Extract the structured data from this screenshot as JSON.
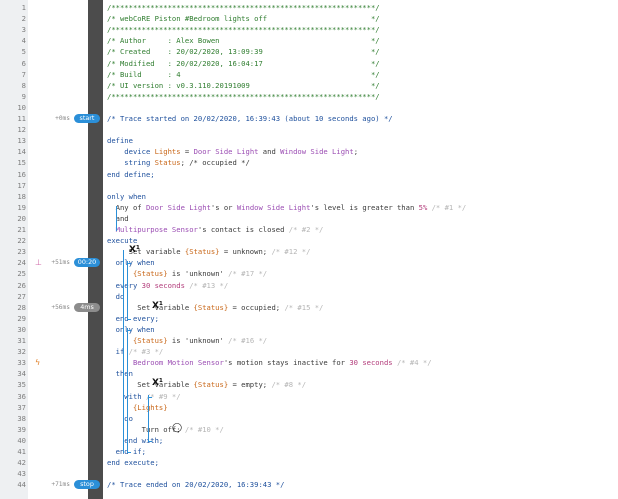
{
  "lines": [
    {
      "n": "1",
      "t": [
        [
          "/*************************************************************/",
          "c"
        ]
      ]
    },
    {
      "n": "2",
      "t": [
        [
          "/* webCoRE Piston #Bedroom lights off                        */",
          "c"
        ]
      ]
    },
    {
      "n": "3",
      "t": [
        [
          "/*************************************************************/",
          "c"
        ]
      ]
    },
    {
      "n": "4",
      "t": [
        [
          "/* Author     : Alex Bowen                                   */",
          "c"
        ]
      ]
    },
    {
      "n": "5",
      "t": [
        [
          "/* Created    : 20/02/2020, 13:09:39                         */",
          "c"
        ]
      ]
    },
    {
      "n": "6",
      "t": [
        [
          "/* Modified   : 20/02/2020, 16:04:17                         */",
          "c"
        ]
      ]
    },
    {
      "n": "7",
      "t": [
        [
          "/* Build      : 4                                            */",
          "c"
        ]
      ]
    },
    {
      "n": "8",
      "t": [
        [
          "/* UI version : v0.3.110.20191009                            */",
          "c"
        ]
      ]
    },
    {
      "n": "9",
      "t": [
        [
          "/*************************************************************/",
          "c"
        ]
      ]
    },
    {
      "n": "10",
      "t": []
    },
    {
      "n": "11",
      "t": [
        [
          "/* Trace started on 20/02/2020, 16:39:43 (about 10 seconds ago) */",
          "k"
        ]
      ]
    },
    {
      "n": "12",
      "t": []
    },
    {
      "n": "13",
      "t": [
        [
          "define",
          "k"
        ]
      ]
    },
    {
      "n": "14",
      "t": [
        [
          "    device ",
          "k"
        ],
        [
          "Lights",
          "v"
        ],
        [
          " = ",
          "s"
        ],
        [
          "Door Side Light",
          "d"
        ],
        [
          " and ",
          "s"
        ],
        [
          "Window Side Light",
          "d"
        ],
        [
          ";",
          "s"
        ]
      ]
    },
    {
      "n": "15",
      "t": [
        [
          "    string ",
          "k"
        ],
        [
          "Status",
          "v"
        ],
        [
          "; /* occupied */",
          "s"
        ]
      ]
    },
    {
      "n": "16",
      "t": [
        [
          "end define;",
          "k"
        ]
      ]
    },
    {
      "n": "17",
      "t": []
    },
    {
      "n": "18",
      "t": [
        [
          "only when",
          "k"
        ]
      ]
    },
    {
      "n": "19",
      "t": [
        [
          "  Any of ",
          "s"
        ],
        [
          "Door Side Light",
          "d"
        ],
        [
          "'s or ",
          "s"
        ],
        [
          "Window Side Light",
          "d"
        ],
        [
          "'s ",
          "s"
        ],
        [
          "level",
          "s"
        ],
        [
          " is greater than ",
          "s"
        ],
        [
          "5%",
          "n"
        ],
        [
          " /* #1 */",
          "g"
        ]
      ]
    },
    {
      "n": "20",
      "t": [
        [
          "  and",
          "s"
        ]
      ]
    },
    {
      "n": "21",
      "t": [
        [
          "  Multipurpose Sensor",
          "d"
        ],
        [
          "'s ",
          "s"
        ],
        [
          "contact",
          "s"
        ],
        [
          " is closed ",
          "s"
        ],
        [
          "/* #2 */",
          "g"
        ]
      ]
    },
    {
      "n": "22",
      "t": [
        [
          "execute",
          "k"
        ]
      ]
    },
    {
      "n": "23",
      "t": [
        [
          "     Set variable ",
          "s"
        ],
        [
          "{Status}",
          "v"
        ],
        [
          " = unknown; ",
          "s"
        ],
        [
          "/* #12 */",
          "g"
        ]
      ]
    },
    {
      "n": "24",
      "t": [
        [
          "  only when",
          "k"
        ]
      ]
    },
    {
      "n": "25",
      "t": [
        [
          "      ",
          "s"
        ],
        [
          "{Status}",
          "v"
        ],
        [
          " is ",
          "s"
        ],
        [
          "'unknown'",
          "s"
        ],
        [
          " /* #17 */",
          "g"
        ]
      ]
    },
    {
      "n": "26",
      "t": [
        [
          "  every ",
          "k"
        ],
        [
          "30 seconds",
          "n"
        ],
        [
          " /* #13 */",
          "g"
        ]
      ]
    },
    {
      "n": "27",
      "t": [
        [
          "  do",
          "k"
        ]
      ]
    },
    {
      "n": "28",
      "t": [
        [
          "       Set variable ",
          "s"
        ],
        [
          "{Status}",
          "v"
        ],
        [
          " = occupied; ",
          "s"
        ],
        [
          "/* #15 */",
          "g"
        ]
      ]
    },
    {
      "n": "29",
      "t": [
        [
          "  end every;",
          "k"
        ]
      ]
    },
    {
      "n": "30",
      "t": [
        [
          "  only when",
          "k"
        ]
      ]
    },
    {
      "n": "31",
      "t": [
        [
          "      ",
          "s"
        ],
        [
          "{Status}",
          "v"
        ],
        [
          " is ",
          "s"
        ],
        [
          "'unknown'",
          "s"
        ],
        [
          " /* #16 */",
          "g"
        ]
      ]
    },
    {
      "n": "32",
      "t": [
        [
          "  if ",
          "k"
        ],
        [
          "/* #3 */",
          "g"
        ]
      ]
    },
    {
      "n": "33",
      "t": [
        [
          "      Bedroom Motion Sensor",
          "d"
        ],
        [
          "'s ",
          "s"
        ],
        [
          "motion",
          "s"
        ],
        [
          " stays inactive for ",
          "s"
        ],
        [
          "30 seconds",
          "n"
        ],
        [
          " /* #4 */",
          "g"
        ]
      ]
    },
    {
      "n": "34",
      "t": [
        [
          "  then",
          "k"
        ]
      ]
    },
    {
      "n": "35",
      "t": [
        [
          "       Set variable ",
          "s"
        ],
        [
          "{Status}",
          "v"
        ],
        [
          " = empty; ",
          "s"
        ],
        [
          "/* #8 */",
          "g"
        ]
      ]
    },
    {
      "n": "36",
      "t": [
        [
          "    with ",
          "k"
        ],
        [
          "/* #9 */",
          "g"
        ]
      ]
    },
    {
      "n": "37",
      "t": [
        [
          "      ",
          "s"
        ],
        [
          "{Lights}",
          "v"
        ]
      ]
    },
    {
      "n": "38",
      "t": [
        [
          "    do",
          "k"
        ]
      ]
    },
    {
      "n": "39",
      "t": [
        [
          "        Turn off; ",
          "s"
        ],
        [
          "/* #10 */",
          "g"
        ]
      ]
    },
    {
      "n": "40",
      "t": [
        [
          "    end with;",
          "k"
        ]
      ]
    },
    {
      "n": "41",
      "t": [
        [
          "  end if;",
          "k"
        ]
      ]
    },
    {
      "n": "42",
      "t": [
        [
          "end execute;",
          "k"
        ]
      ]
    },
    {
      "n": "43",
      "t": []
    },
    {
      "n": "44",
      "t": [
        [
          "/* Trace ended on 20/02/2020, 16:39:43 */",
          "k"
        ]
      ]
    }
  ],
  "trace_markers": [
    {
      "line": 11,
      "time": "+0ms",
      "badge": "start",
      "style": "bl"
    },
    {
      "line": 24,
      "time": "+51ms",
      "badge": "00:20",
      "style": "bl"
    },
    {
      "line": 28,
      "time": "+56ms",
      "badge": "4ms",
      "style": "gr"
    },
    {
      "line": 44,
      "time": "+71ms",
      "badge": "stop",
      "style": "bl"
    }
  ],
  "gutter_icons": [
    {
      "line": 24,
      "glyph": "⊥",
      "name": "timer-event-icon",
      "cls": ""
    },
    {
      "line": 33,
      "glyph": "ϟ",
      "name": "condition-flash-icon",
      "cls": "o"
    }
  ],
  "statement_icons": [
    {
      "line": 23,
      "glyph": "X¹",
      "name": "set-variable-icon"
    },
    {
      "line": 28,
      "glyph": "X¹",
      "name": "set-variable-icon"
    },
    {
      "line": 35,
      "glyph": "X¹",
      "name": "set-variable-icon"
    },
    {
      "line": 39,
      "glyph": "◯",
      "name": "power-icon"
    }
  ],
  "colors": {
    "comment": "#2f7d2f",
    "keyword": "#1d4f9c",
    "variable": "#c9681a",
    "device": "#9b4db3",
    "number": "#b23b7a",
    "accent": "#2b8fd8"
  }
}
